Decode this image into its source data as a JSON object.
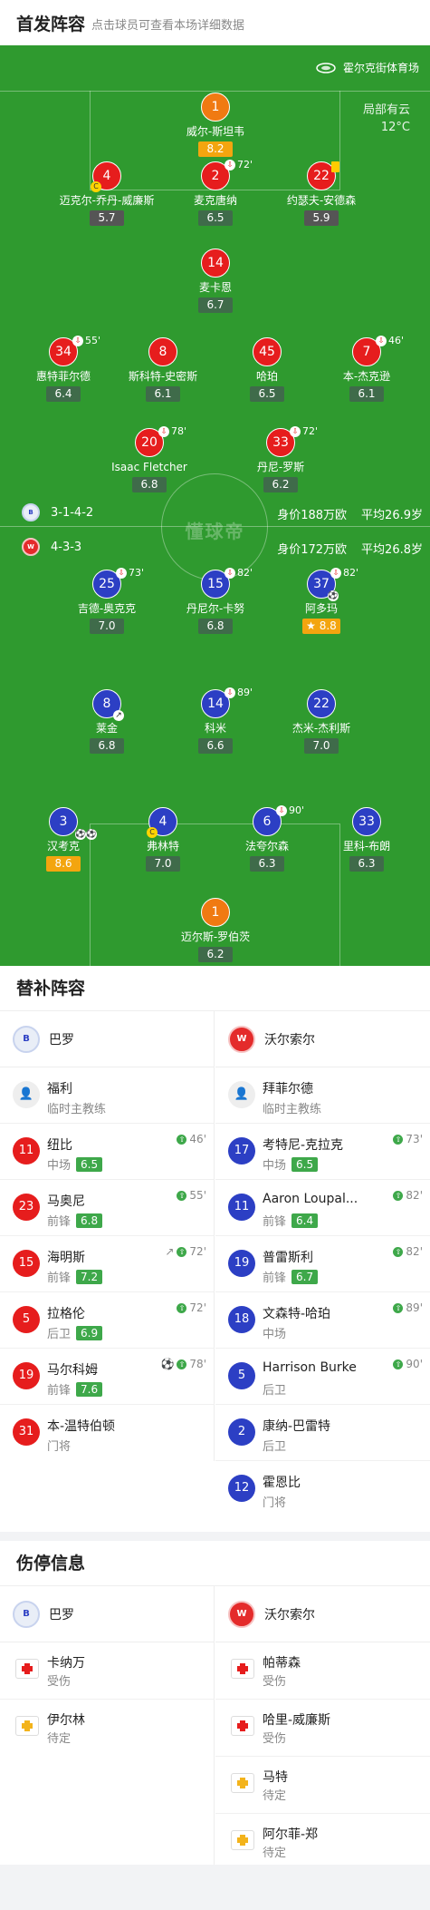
{
  "header": {
    "title": "首发阵容",
    "subtitle": "点击球员可查看本场详细数据"
  },
  "pitch": {
    "venue": "霍尔克街体育场",
    "weather": "局部有云",
    "temperature": "12°C",
    "watermark": "懂球帝",
    "home": {
      "formation": "3-1-4-2",
      "value": "身价188万欧",
      "avg_age": "平均26.9岁"
    },
    "away": {
      "formation": "4-3-3",
      "value": "身价172万欧",
      "avg_age": "平均26.8岁"
    },
    "home_players": [
      {
        "num": "1",
        "name": "威尔-斯坦韦",
        "rating": "8.2",
        "sub": ""
      },
      {
        "num": "4",
        "name": "迈克尔-乔丹-威廉斯",
        "rating": "5.7",
        "sub": ""
      },
      {
        "num": "2",
        "name": "麦克唐纳",
        "rating": "6.5",
        "sub": "72'"
      },
      {
        "num": "22",
        "name": "约瑟夫-安德森",
        "rating": "5.9",
        "sub": ""
      },
      {
        "num": "14",
        "name": "麦卡恩",
        "rating": "6.7",
        "sub": ""
      },
      {
        "num": "34",
        "name": "惠特菲尔德",
        "rating": "6.4",
        "sub": "55'"
      },
      {
        "num": "8",
        "name": "斯科特-史密斯",
        "rating": "6.1",
        "sub": ""
      },
      {
        "num": "45",
        "name": "哈珀",
        "rating": "6.5",
        "sub": ""
      },
      {
        "num": "7",
        "name": "本-杰克逊",
        "rating": "6.1",
        "sub": "46'"
      },
      {
        "num": "20",
        "name": "Isaac Fletcher",
        "rating": "6.8",
        "sub": "78'"
      },
      {
        "num": "33",
        "name": "丹尼-罗斯",
        "rating": "6.2",
        "sub": "72'"
      }
    ],
    "away_players": [
      {
        "num": "25",
        "name": "吉德-奥克克",
        "rating": "7.0",
        "sub": "73'"
      },
      {
        "num": "15",
        "name": "丹尼尔-卡努",
        "rating": "6.8",
        "sub": "82'"
      },
      {
        "num": "37",
        "name": "阿多玛",
        "rating": "8.8",
        "sub": "82'"
      },
      {
        "num": "8",
        "name": "莱金",
        "rating": "6.8",
        "sub": ""
      },
      {
        "num": "14",
        "name": "科米",
        "rating": "6.6",
        "sub": "89'"
      },
      {
        "num": "22",
        "name": "杰米-杰利斯",
        "rating": "7.0",
        "sub": ""
      },
      {
        "num": "3",
        "name": "汉考克",
        "rating": "8.6",
        "sub": ""
      },
      {
        "num": "4",
        "name": "弗林特",
        "rating": "7.0",
        "sub": ""
      },
      {
        "num": "6",
        "name": "法夸尔森",
        "rating": "6.3",
        "sub": "90'"
      },
      {
        "num": "33",
        "name": "里科-布朗",
        "rating": "6.3",
        "sub": ""
      },
      {
        "num": "1",
        "name": "迈尔斯-罗伯茨",
        "rating": "6.2",
        "sub": ""
      }
    ]
  },
  "subs": {
    "title": "替补阵容",
    "home_team": "巴罗",
    "away_team": "沃尔索尔",
    "home": [
      {
        "num": "",
        "name": "福利",
        "pos": "临时主教练",
        "rating": "",
        "in": ""
      },
      {
        "num": "11",
        "name": "纽比",
        "pos": "中场",
        "rating": "6.5",
        "in": "46'"
      },
      {
        "num": "23",
        "name": "马奥尼",
        "pos": "前锋",
        "rating": "6.8",
        "in": "55'"
      },
      {
        "num": "15",
        "name": "海明斯",
        "pos": "前锋",
        "rating": "7.2",
        "in": "72'"
      },
      {
        "num": "5",
        "name": "拉格伦",
        "pos": "后卫",
        "rating": "6.9",
        "in": "72'"
      },
      {
        "num": "19",
        "name": "马尔科姆",
        "pos": "前锋",
        "rating": "7.6",
        "in": "78'"
      },
      {
        "num": "31",
        "name": "本-温特伯顿",
        "pos": "门将",
        "rating": "",
        "in": ""
      }
    ],
    "away": [
      {
        "num": "",
        "name": "拜菲尔德",
        "pos": "临时主教练",
        "rating": "",
        "in": ""
      },
      {
        "num": "17",
        "name": "考特尼-克拉克",
        "pos": "中场",
        "rating": "6.5",
        "in": "73'"
      },
      {
        "num": "11",
        "name": "Aaron Loupal...",
        "pos": "前锋",
        "rating": "6.4",
        "in": "82'"
      },
      {
        "num": "19",
        "name": "普雷斯利",
        "pos": "前锋",
        "rating": "6.7",
        "in": "82'"
      },
      {
        "num": "18",
        "name": "文森特-哈珀",
        "pos": "中场",
        "rating": "",
        "in": "89'"
      },
      {
        "num": "5",
        "name": "Harrison Burke",
        "pos": "后卫",
        "rating": "",
        "in": "90'"
      },
      {
        "num": "2",
        "name": "康纳-巴雷特",
        "pos": "后卫",
        "rating": "",
        "in": ""
      },
      {
        "num": "12",
        "name": "霍恩比",
        "pos": "门将",
        "rating": "",
        "in": ""
      }
    ]
  },
  "injuries": {
    "title": "伤停信息",
    "home_team": "巴罗",
    "away_team": "沃尔索尔",
    "home": [
      {
        "name": "卡纳万",
        "status": "受伤",
        "type": "red"
      },
      {
        "name": "伊尔林",
        "status": "待定",
        "type": "yel"
      }
    ],
    "away": [
      {
        "name": "帕蒂森",
        "status": "受伤",
        "type": "red"
      },
      {
        "name": "哈里-威廉斯",
        "status": "受伤",
        "type": "red"
      },
      {
        "name": "马特",
        "status": "待定",
        "type": "yel"
      },
      {
        "name": "阿尔菲-郑",
        "status": "待定",
        "type": "yel"
      }
    ]
  },
  "colors": {
    "pitch": "#2f9a2f",
    "home_kit": "#e61d1d",
    "away_kit": "#2c3fc4",
    "keeper": "#f07a12",
    "star_rating": "#f3a50f"
  }
}
